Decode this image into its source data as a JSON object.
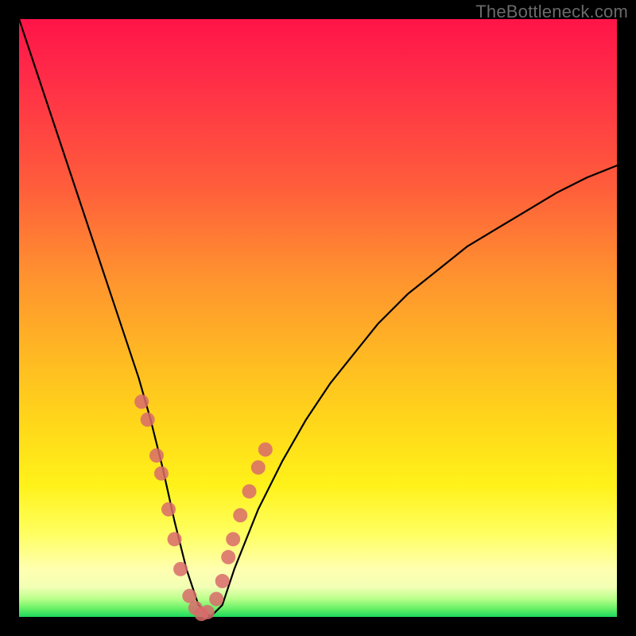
{
  "watermark": "TheBottleneck.com",
  "chart_data": {
    "type": "line",
    "title": "",
    "xlabel": "",
    "ylabel": "",
    "xlim": [
      0,
      100
    ],
    "ylim": [
      0,
      100
    ],
    "series": [
      {
        "name": "bottleneck-curve",
        "x": [
          0,
          2,
          4,
          6,
          8,
          10,
          12,
          14,
          16,
          18,
          20,
          22,
          24,
          26,
          28,
          30,
          32,
          34,
          36,
          40,
          44,
          48,
          52,
          56,
          60,
          65,
          70,
          75,
          80,
          85,
          90,
          95,
          100
        ],
        "values": [
          100,
          94,
          88,
          82,
          76,
          70,
          64,
          58,
          52,
          46,
          40,
          33,
          25,
          16,
          8,
          2,
          0,
          2,
          8,
          18,
          26,
          33,
          39,
          44,
          49,
          54,
          58,
          62,
          65,
          68,
          71,
          73.5,
          75.5
        ]
      }
    ],
    "markers": {
      "name": "highlight-points",
      "color": "#d86b6b",
      "x": [
        20.5,
        21.5,
        23,
        23.8,
        25,
        26,
        27,
        28.5,
        29.5,
        30.5,
        31.5,
        33,
        34,
        35,
        35.8,
        37,
        38.5,
        40,
        41.2
      ],
      "values": [
        36,
        33,
        27,
        24,
        18,
        13,
        8,
        3.5,
        1.5,
        0.5,
        0.8,
        3,
        6,
        10,
        13,
        17,
        21,
        25,
        28
      ]
    }
  }
}
